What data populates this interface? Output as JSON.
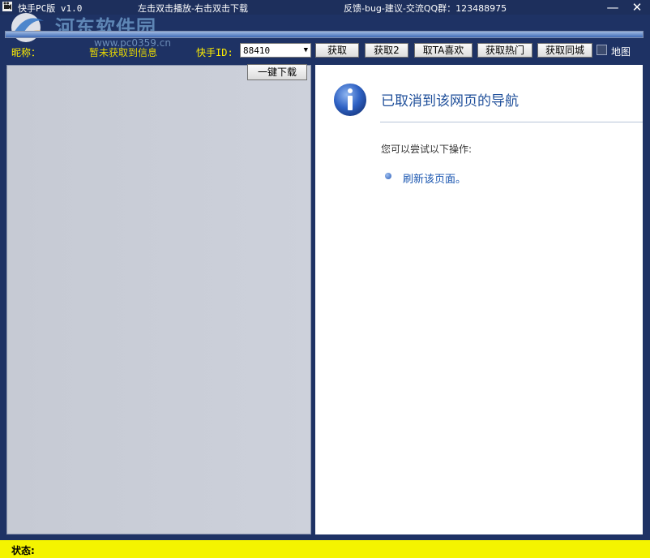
{
  "window": {
    "title": "快手PC版 v1.0",
    "hint": "左击双击播放-右击双击下载",
    "feedback": "反馈-bug-建议-交流QQ群：123488975",
    "minimize_glyph": "—",
    "close_glyph": "✕"
  },
  "watermark": {
    "text": "河东软件园",
    "url": "www.pc0359.cn"
  },
  "progress": {
    "value_percent": 100
  },
  "toolbar": {
    "nickname_label": "昵称：",
    "nickname_value": "暂未获取到信息",
    "id_label": "快手ID:",
    "id_value": "88410",
    "dropdown_arrow": "▼",
    "buttons": [
      "获取",
      "获取2",
      "取TA喜欢",
      "获取热门",
      "获取同城"
    ],
    "map_label": "地图"
  },
  "left_panel": {
    "download_all_label": "一键下载"
  },
  "browser": {
    "heading": "已取消到该网页的导航",
    "try_text": "您可以尝试以下操作:",
    "refresh_link": "刷新该页面。"
  },
  "status": {
    "label": "状态:"
  },
  "colors": {
    "window_bg": "#1e3264",
    "status_bg": "#f4f400",
    "label_yellow": "#ffee00",
    "link_blue": "#1a56b0"
  },
  "icons": [
    "app-icon",
    "minimize-icon",
    "close-icon",
    "dropdown-arrow-icon",
    "info-icon",
    "bullet-icon"
  ]
}
